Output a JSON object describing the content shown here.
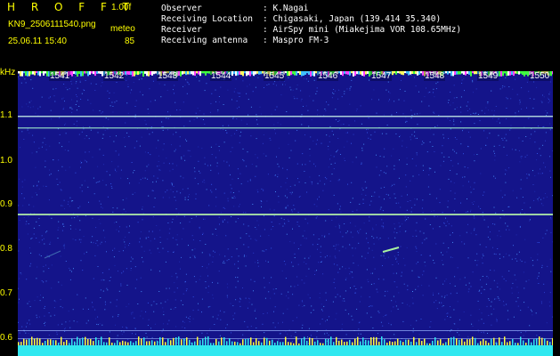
{
  "header": {
    "brand": "H R O F F T",
    "version": "1.00f",
    "filename": "KN9_2506111540.png",
    "meteo_label": "meteo",
    "datetime": "25.06.11 15:40",
    "count": "85"
  },
  "info": [
    {
      "label": "Observer",
      "value": ": K.Nagai"
    },
    {
      "label": "Receiving Location",
      "value": ": Chigasaki, Japan (139.414 35.340)"
    },
    {
      "label": "Receiver",
      "value": ": AirSpy mini (Miakejima VOR 108.65MHz)"
    },
    {
      "label": "Receiving antenna",
      "value": ": Maspro FM-3"
    }
  ],
  "yaxis": {
    "unit": "kHz",
    "ticks": [
      "1.1",
      "1.0",
      "0.9",
      "0.8",
      "0.7",
      "0.6"
    ]
  },
  "time_labels": [
    "1541",
    "1542",
    "1543",
    "1544",
    "1545",
    "1546",
    "1547",
    "1548",
    "1549",
    "1550"
  ],
  "colors": {
    "background": "#14148a",
    "header_text": "#ffff00",
    "info_text": "#ffffff",
    "line": "#aef5d0"
  }
}
